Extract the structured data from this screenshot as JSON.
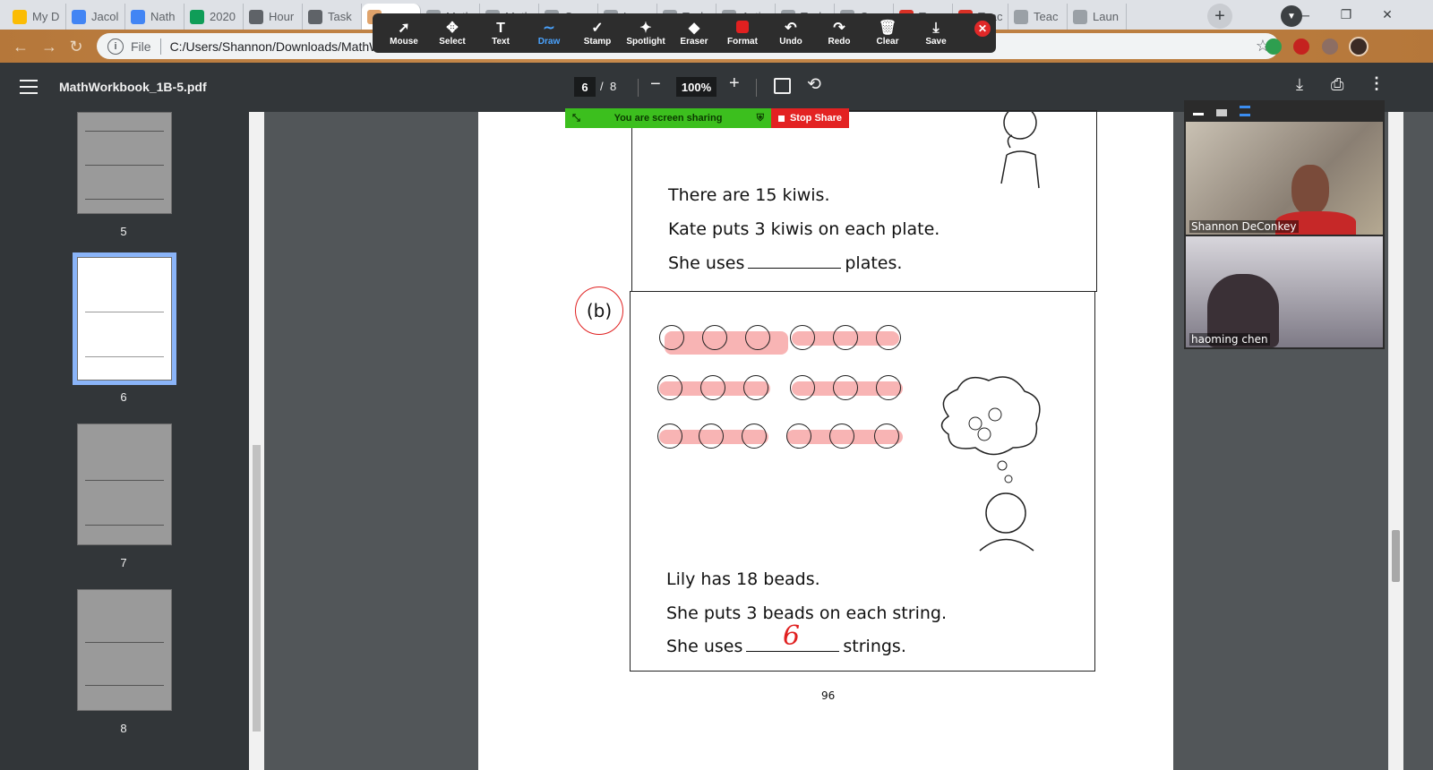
{
  "browser": {
    "tabs": [
      {
        "label": "My D",
        "color": "#fbbc04"
      },
      {
        "label": "Jacol",
        "color": "#4285f4"
      },
      {
        "label": "Nath",
        "color": "#4285f4"
      },
      {
        "label": "2020",
        "color": "#0f9d58"
      },
      {
        "label": "Hour",
        "color": "#5f6368"
      },
      {
        "label": "Task",
        "color": "#5f6368"
      },
      {
        "label": "",
        "color": "#e0a36b"
      },
      {
        "label": "Math",
        "color": "#9aa0a6"
      },
      {
        "label": "Math",
        "color": "#9aa0a6"
      },
      {
        "label": "Cou",
        "color": "#9aa0a6"
      },
      {
        "label": "Less",
        "color": "#9aa0a6"
      },
      {
        "label": "Tasl",
        "color": "#9aa0a6"
      },
      {
        "label": "Acti",
        "color": "#9aa0a6"
      },
      {
        "label": "Tasl",
        "color": "#9aa0a6"
      },
      {
        "label": "Cou",
        "color": "#9aa0a6"
      },
      {
        "label": "Teac",
        "color": "#d93025"
      },
      {
        "label": "Teac",
        "color": "#d93025"
      },
      {
        "label": "Teac",
        "color": "#9aa0a6"
      },
      {
        "label": "Laun",
        "color": "#9aa0a6"
      }
    ],
    "address": {
      "scheme_label": "File",
      "url": "C:/Users/Shannon/Downloads/MathWo"
    }
  },
  "zoom_toolbar": {
    "tools": [
      {
        "label": "Mouse",
        "icon": "cursor-icon",
        "glyph": "➚"
      },
      {
        "label": "Select",
        "icon": "move-icon",
        "glyph": "✥"
      },
      {
        "label": "Text",
        "icon": "text-icon",
        "glyph": "T"
      },
      {
        "label": "Draw",
        "icon": "draw-icon",
        "glyph": "∼"
      },
      {
        "label": "Stamp",
        "icon": "stamp-icon",
        "glyph": "✓"
      },
      {
        "label": "Spotlight",
        "icon": "spotlight-icon",
        "glyph": "✦"
      },
      {
        "label": "Eraser",
        "icon": "eraser-icon",
        "glyph": "◆"
      },
      {
        "label": "Format",
        "icon": "format-icon",
        "glyph": "■"
      },
      {
        "label": "Undo",
        "icon": "undo-icon",
        "glyph": "↶"
      },
      {
        "label": "Redo",
        "icon": "redo-icon",
        "glyph": "↷"
      },
      {
        "label": "Clear",
        "icon": "trash-icon",
        "glyph": "🗑"
      },
      {
        "label": "Save",
        "icon": "save-icon",
        "glyph": "⤓"
      }
    ],
    "active_tool": "Draw",
    "format_color": "#e02020"
  },
  "pdf_viewer": {
    "title": "MathWorkbook_1B-5.pdf",
    "current_page": "6",
    "page_separator": "/",
    "total_pages": "8",
    "zoom": "100%",
    "thumbnails": [
      {
        "page": "5"
      },
      {
        "page": "6",
        "selected": true
      },
      {
        "page": "7"
      },
      {
        "page": "8"
      }
    ]
  },
  "screen_share": {
    "status": "You are screen sharing",
    "stop_label": "Stop Share",
    "status_color": "#3cbf1e",
    "stop_color": "#e32222"
  },
  "worksheet": {
    "part_a": {
      "line1": "There are 15 kiwis.",
      "line2": "Kate puts 3 kiwis on each plate.",
      "line3_before": "She uses",
      "line3_after": "plates."
    },
    "part_b": {
      "label": "(b)",
      "line1": "Lily has 18 beads.",
      "line2": "She puts 3 beads on each string.",
      "line3_before": "She uses",
      "line3_after": "strings.",
      "handwritten_answer": "6",
      "bead_count": 18,
      "highlight_color": "#f58c8c"
    },
    "page_number": "96"
  },
  "video_panel": {
    "participants": [
      {
        "name": "Shannon DeConkey"
      },
      {
        "name": "haoming chen"
      }
    ]
  }
}
